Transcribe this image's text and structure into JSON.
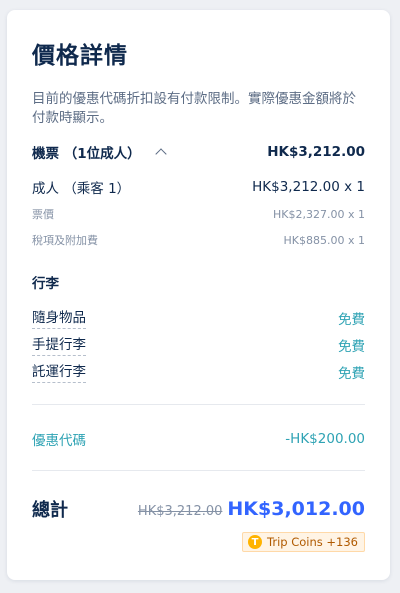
{
  "panel": {
    "title": "價格詳情",
    "notice": "目前的優惠代碼折扣設有付款限制。實際優惠金額將於付款時顯示。"
  },
  "flight": {
    "label": "機票 （1位成人）",
    "total": "HK$3,212.00",
    "adult_label": "成人 （乘客 1）",
    "adult_price": "HK$3,212.00 x 1",
    "fare_label": "票價",
    "fare_price": "HK$2,327.00 x 1",
    "tax_label": "稅項及附加費",
    "tax_price": "HK$885.00 x 1"
  },
  "baggage": {
    "heading": "行李",
    "items": [
      {
        "label": "隨身物品",
        "value": "免費"
      },
      {
        "label": "手提行李",
        "value": "免費"
      },
      {
        "label": "託運行李",
        "value": "免費"
      }
    ]
  },
  "promo": {
    "label": "優惠代碼",
    "value": "-HK$200.00"
  },
  "total": {
    "label": "總計",
    "original": "HK$3,212.00",
    "final": "HK$3,012.00",
    "coins_icon_char": "T",
    "coins_text": "Trip Coins +136"
  },
  "colors": {
    "primary_text": "#0f294d",
    "accent_teal": "#2fa3b4",
    "price_blue": "#3264ff",
    "coin_orange": "#ffb300"
  }
}
